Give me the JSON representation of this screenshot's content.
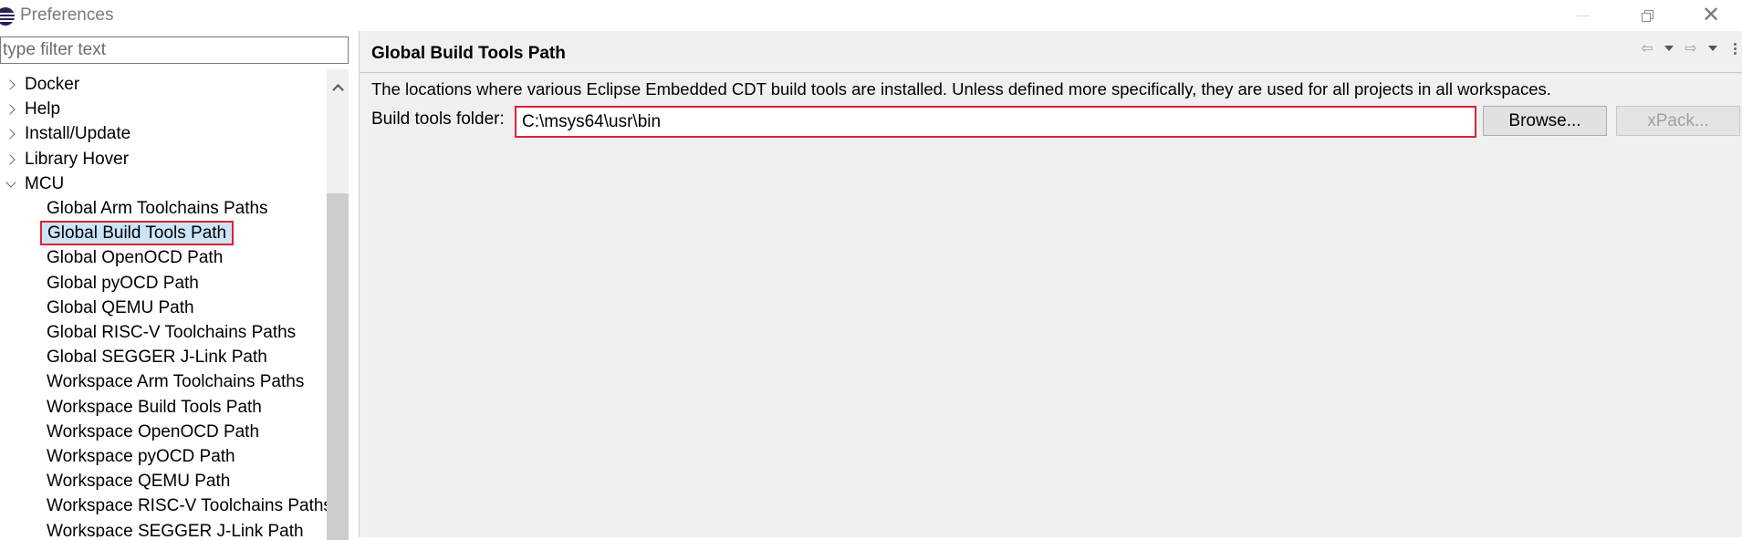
{
  "window": {
    "title": "Preferences"
  },
  "left_panel": {
    "filter_placeholder": "type filter text",
    "tree": [
      {
        "label": "Docker",
        "level": 0,
        "expandable": true,
        "expanded": false
      },
      {
        "label": "Help",
        "level": 0,
        "expandable": true,
        "expanded": false
      },
      {
        "label": "Install/Update",
        "level": 0,
        "expandable": true,
        "expanded": false
      },
      {
        "label": "Library Hover",
        "level": 0,
        "expandable": true,
        "expanded": false
      },
      {
        "label": "MCU",
        "level": 0,
        "expandable": true,
        "expanded": true
      },
      {
        "label": "Global Arm Toolchains Paths",
        "level": 1
      },
      {
        "label": "Global Build Tools Path",
        "level": 1,
        "selected": true
      },
      {
        "label": "Global OpenOCD Path",
        "level": 1
      },
      {
        "label": "Global pyOCD Path",
        "level": 1
      },
      {
        "label": "Global QEMU Path",
        "level": 1
      },
      {
        "label": "Global RISC-V Toolchains Paths",
        "level": 1
      },
      {
        "label": "Global SEGGER J-Link Path",
        "level": 1
      },
      {
        "label": "Workspace Arm Toolchains Paths",
        "level": 1
      },
      {
        "label": "Workspace Build Tools Path",
        "level": 1
      },
      {
        "label": "Workspace OpenOCD Path",
        "level": 1
      },
      {
        "label": "Workspace pyOCD Path",
        "level": 1
      },
      {
        "label": "Workspace QEMU Path",
        "level": 1
      },
      {
        "label": "Workspace RISC-V Toolchains Paths",
        "level": 1
      },
      {
        "label": "Workspace SEGGER J-Link Path",
        "level": 1
      }
    ]
  },
  "right_panel": {
    "title": "Global Build Tools Path",
    "description": "The locations where various Eclipse Embedded CDT build tools are installed. Unless defined more specifically, they are used for all projects in all workspaces.",
    "field_label": "Build tools folder:",
    "field_value": "C:\\msys64\\usr\\bin",
    "browse_label": "Browse...",
    "xpack_label": "xPack..."
  },
  "colors": {
    "highlight_border": "#e02030",
    "selection_bg": "#cce4f7",
    "panel_bg": "#f0f0f0"
  },
  "icons": {
    "app": "eclipse-icon",
    "back": "back-arrow-icon",
    "forward": "forward-arrow-icon",
    "menu": "view-menu-icon"
  }
}
